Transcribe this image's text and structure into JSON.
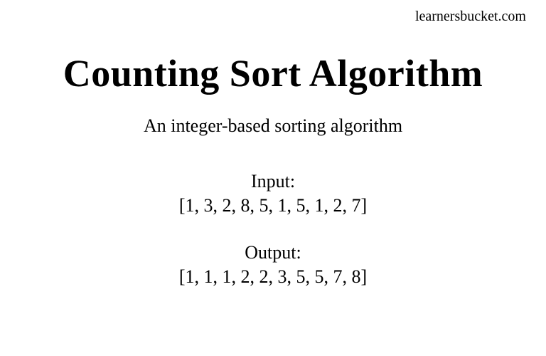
{
  "brand": "learnersbucket.com",
  "title": "Counting Sort Algorithm",
  "subtitle": "An integer-based sorting algorithm",
  "input": {
    "label": "Input:",
    "value": "[1, 3, 2, 8, 5, 1, 5, 1, 2, 7]"
  },
  "output": {
    "label": "Output:",
    "value": "[1, 1, 1, 2, 2, 3, 5, 5, 7, 8]"
  }
}
